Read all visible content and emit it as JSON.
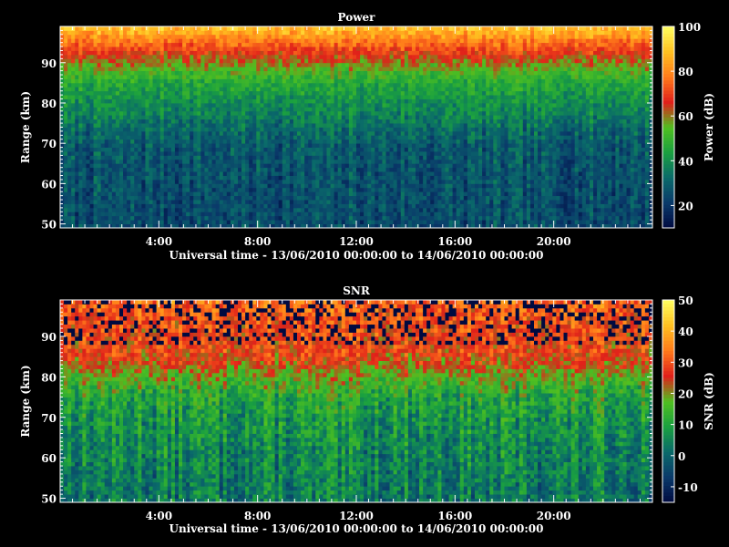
{
  "chart_data": [
    {
      "type": "heatmap",
      "title": "Power",
      "xlabel": "Universal time - 13/06/2010 00:00:00 to 14/06/2010 00:00:00",
      "ylabel": "Range (km)",
      "colorbar_label": "Power (dB)",
      "x_range_hours": [
        0,
        24
      ],
      "x_ticks": [
        "4:00",
        "8:00",
        "12:00",
        "16:00",
        "20:00"
      ],
      "x_tick_hours": [
        4,
        8,
        12,
        16,
        20
      ],
      "ylim": [
        49,
        99
      ],
      "y_ticks": [
        50,
        60,
        70,
        80,
        90
      ],
      "colorbar_range": [
        10,
        100
      ],
      "colorbar_ticks": [
        20,
        40,
        60,
        80,
        100
      ],
      "colormap": [
        "#000a40",
        "#0a3a6a",
        "#0a6a6a",
        "#1aa040",
        "#50c020",
        "#e0201a",
        "#ff7a1a",
        "#ffc020",
        "#ffff60"
      ],
      "profile_range_km": [
        50,
        60,
        70,
        75,
        80,
        85,
        88,
        92,
        96,
        99
      ],
      "profile_values_db": [
        25,
        26,
        28,
        34,
        40,
        46,
        54,
        66,
        80,
        90
      ],
      "seed": 7
    },
    {
      "type": "heatmap",
      "title": "SNR",
      "xlabel": "Universal time - 13/06/2010 00:00:00 to 14/06/2010 00:00:00",
      "ylabel": "Range (km)",
      "colorbar_label": "SNR (dB)",
      "x_range_hours": [
        0,
        24
      ],
      "x_ticks": [
        "4:00",
        "8:00",
        "12:00",
        "16:00",
        "20:00"
      ],
      "x_tick_hours": [
        4,
        8,
        12,
        16,
        20
      ],
      "ylim": [
        49,
        99
      ],
      "y_ticks": [
        50,
        60,
        70,
        80,
        90
      ],
      "colorbar_range": [
        -15,
        50
      ],
      "colorbar_ticks": [
        -10,
        0,
        10,
        20,
        30,
        40,
        50
      ],
      "colormap": [
        "#000a40",
        "#0a3a6a",
        "#0a6a6a",
        "#1aa040",
        "#50c020",
        "#e0201a",
        "#ff7a1a",
        "#ffc020",
        "#ffff60"
      ],
      "profile_range_km": [
        50,
        60,
        70,
        75,
        80,
        83,
        86,
        90,
        95,
        99
      ],
      "profile_values_db": [
        3,
        5,
        8,
        11,
        18,
        24,
        27,
        28,
        30,
        33
      ],
      "seed": 13
    }
  ]
}
